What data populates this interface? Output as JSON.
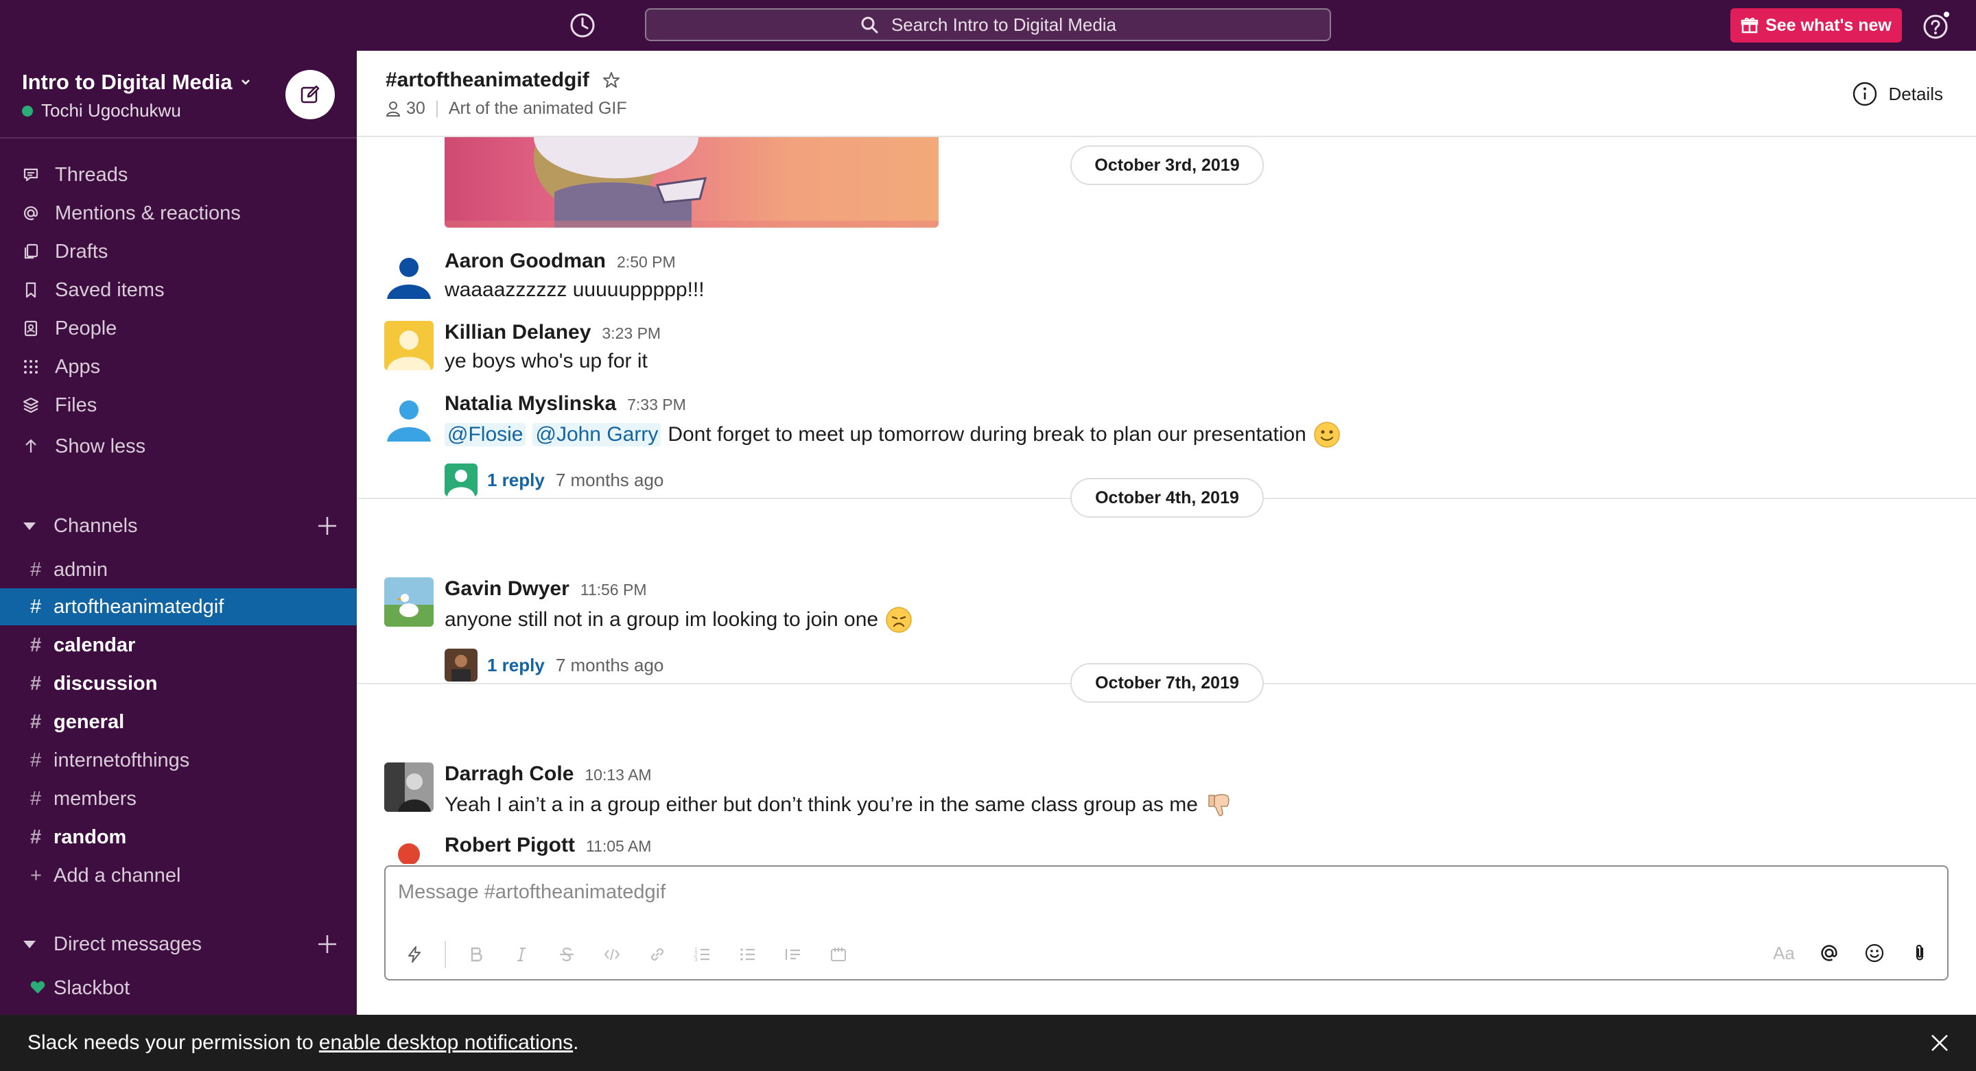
{
  "topbar": {
    "search_placeholder": "Search Intro to Digital Media",
    "whats_new_label": "See what's new",
    "accent_color": "#e01e5a"
  },
  "workspace": {
    "name": "Intro to Digital Media",
    "user": "Tochi Ugochukwu",
    "presence": "active"
  },
  "nav": [
    {
      "label": "Threads",
      "icon": "threads-icon"
    },
    {
      "label": "Mentions & reactions",
      "icon": "at-icon"
    },
    {
      "label": "Drafts",
      "icon": "drafts-icon"
    },
    {
      "label": "Saved items",
      "icon": "bookmark-icon"
    },
    {
      "label": "People",
      "icon": "people-icon"
    },
    {
      "label": "Apps",
      "icon": "apps-grid-icon"
    },
    {
      "label": "Files",
      "icon": "files-icon"
    },
    {
      "label": "Show less",
      "icon": "arrow-up-icon"
    }
  ],
  "channels_section": {
    "title": "Channels",
    "items": [
      {
        "name": "admin",
        "bold": false,
        "active": false
      },
      {
        "name": "artoftheanimatedgif",
        "bold": false,
        "active": true
      },
      {
        "name": "calendar",
        "bold": true,
        "active": false
      },
      {
        "name": "discussion",
        "bold": true,
        "active": false
      },
      {
        "name": "general",
        "bold": true,
        "active": false
      },
      {
        "name": "internetofthings",
        "bold": false,
        "active": false
      },
      {
        "name": "members",
        "bold": false,
        "active": false
      },
      {
        "name": "random",
        "bold": true,
        "active": false
      }
    ],
    "add_label": "Add a channel"
  },
  "dm_section": {
    "title": "Direct messages",
    "items": [
      {
        "name": "Slackbot"
      }
    ]
  },
  "channel": {
    "title": "#artoftheanimatedgif",
    "member_count": "30",
    "topic": "Art of the animated GIF",
    "details_label": "Details"
  },
  "dates": {
    "d1": "October 3rd, 2019",
    "d2": "October 4th, 2019",
    "d3": "October 7th, 2019"
  },
  "messages": [
    {
      "author": "Aaron Goodman",
      "time": "2:50 PM",
      "text": "waaaazzzzzz uuuuuppppp!!!"
    },
    {
      "author": "Killian Delaney",
      "time": "3:23 PM",
      "text": "ye boys who's up for it"
    },
    {
      "author": "Natalia Myslinska",
      "time": "7:33 PM",
      "mentions": [
        "@Flosie",
        "@John Garry"
      ],
      "text": "Dont forget to meet up tomorrow during break to plan our presentation",
      "emoji": "slightly-smiling-face",
      "replies": "1 reply",
      "replies_ago": "7 months ago"
    },
    {
      "author": "Gavin Dwyer",
      "time": "11:56 PM",
      "text": "anyone still not in a group im looking to join one",
      "emoji": "disappointed-face",
      "replies": "1 reply",
      "replies_ago": "7 months ago"
    },
    {
      "author": "Darragh Cole",
      "time": "10:13 AM",
      "text": "Yeah I ain’t a in a group either but don’t think you’re in the same class group as me",
      "emoji": "thumbs-down"
    },
    {
      "author": "Robert Pigott",
      "time": "11:05 AM",
      "text": ""
    }
  ],
  "composer": {
    "placeholder": "Message #artoftheanimatedgif",
    "font_toggle": "Aa"
  },
  "banner": {
    "text": "Slack needs your permission to",
    "link": "enable desktop notifications",
    "end": "."
  }
}
